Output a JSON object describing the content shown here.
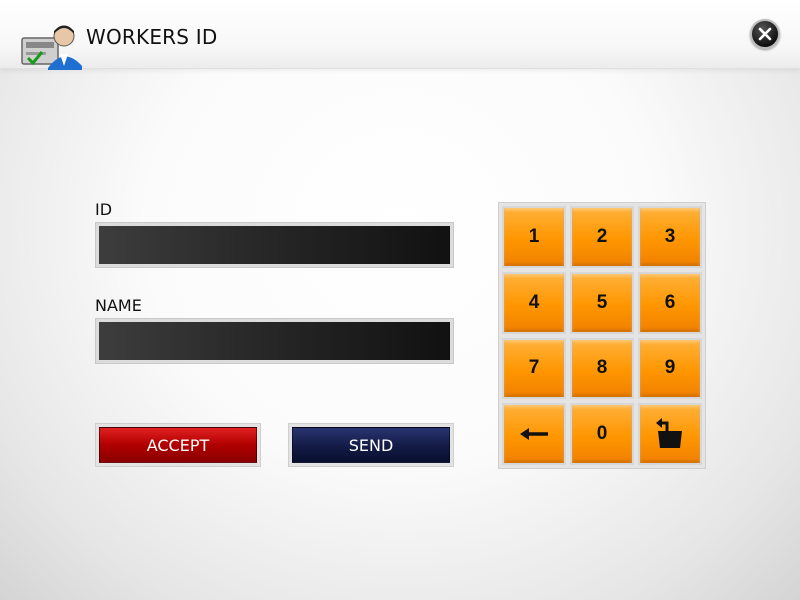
{
  "header": {
    "title": "WORKERS ID",
    "app_icon": "worker-id-icon",
    "close_icon": "close-icon"
  },
  "form": {
    "id_label": "ID",
    "id_value": "",
    "name_label": "NAME",
    "name_value": ""
  },
  "buttons": {
    "accept_label": "ACCEPT",
    "send_label": "SEND"
  },
  "keypad": {
    "keys": [
      "1",
      "2",
      "3",
      "4",
      "5",
      "6",
      "7",
      "8",
      "9",
      "←",
      "0",
      "shift-icon"
    ]
  },
  "colors": {
    "accept": "#c00000",
    "send": "#141c48",
    "keypad": "#ff9600"
  }
}
